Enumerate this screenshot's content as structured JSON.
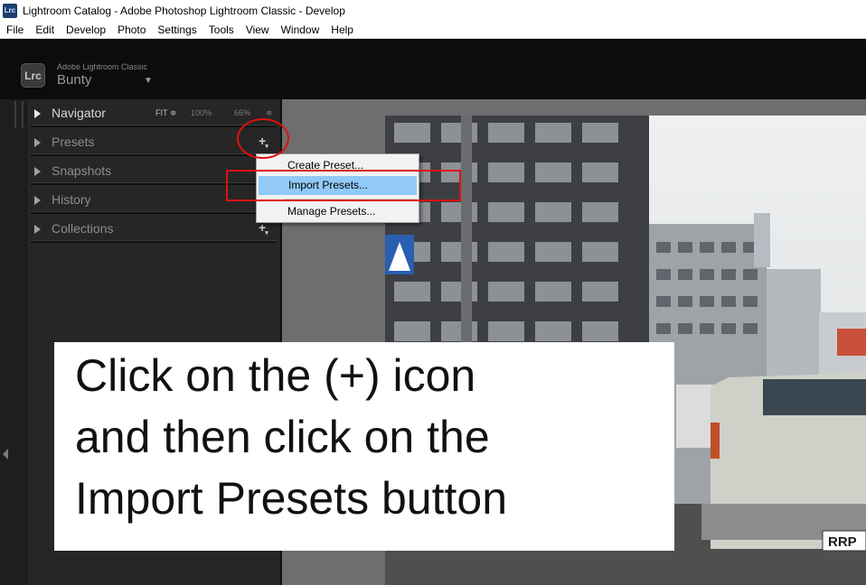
{
  "window": {
    "title": "Lightroom Catalog - Adobe Photoshop Lightroom Classic - Develop",
    "app_icon_text": "Lrc"
  },
  "menubar": {
    "items": [
      "File",
      "Edit",
      "Develop",
      "Photo",
      "Settings",
      "Tools",
      "View",
      "Window",
      "Help"
    ]
  },
  "identity": {
    "badge": "Lrc",
    "brand": "Adobe Lightroom Classic",
    "catalog": "Bunty",
    "caret": "▼"
  },
  "left_panel": {
    "navigator": {
      "label": "Navigator",
      "fit": "FIT ≑",
      "zoom_100": "100%",
      "zoom_66": "66%",
      "updown": "≑"
    },
    "sections": [
      {
        "label": "Presets"
      },
      {
        "label": "Snapshots"
      },
      {
        "label": "History"
      },
      {
        "label": "Collections"
      }
    ],
    "presets_plus": "+",
    "collections_plus": "+"
  },
  "context_menu": {
    "items": [
      {
        "label": "Create Preset..."
      },
      {
        "label": "Import Presets..."
      },
      {
        "label": "Manage Presets..."
      }
    ]
  },
  "instruction": {
    "lines": [
      "Click on the (+) icon",
      "and then click on the",
      "Import Presets button"
    ]
  },
  "photo": {
    "plate_text": "RRP"
  },
  "colors": {
    "annotation_red": "#e01010",
    "menu_highlight": "#91c9f7",
    "panel_bg": "#262626"
  }
}
